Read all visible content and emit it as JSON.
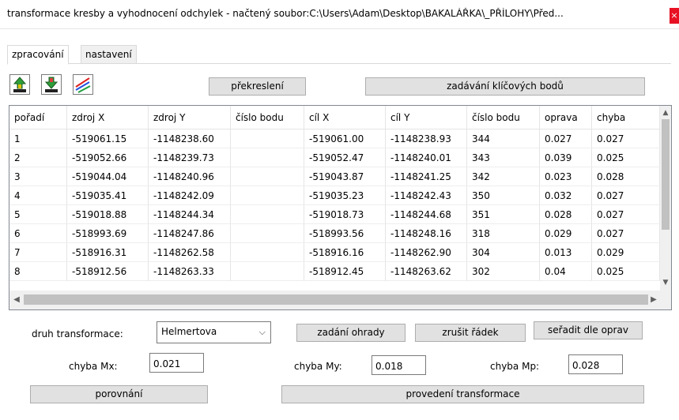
{
  "window": {
    "title": "transformace kresby a vyhodnocení odchylek - načtený soubor:C:\\Users\\Adam\\Desktop\\BAKALÁŘKA\\_PŘÍLOHY\\Před...",
    "close_glyph": "×"
  },
  "tabs": [
    {
      "label": "zpracování",
      "active": true
    },
    {
      "label": "nastavení",
      "active": false
    }
  ],
  "toolbar": {
    "icons": [
      "upload-arrow-icon",
      "download-arrow-icon",
      "line-chart-icon"
    ],
    "redraw_label": "překreslení",
    "keypoints_label": "zadávání klíčových bodů"
  },
  "table": {
    "columns": [
      "pořadí",
      "zdroj X",
      "zdroj Y",
      "číslo bodu",
      "cíl X",
      "cíl Y",
      "číslo bodu",
      "oprava",
      "chyba"
    ],
    "rows": [
      [
        "1",
        "-519061.15",
        "-1148238.60",
        "",
        "-519061.00",
        "-1148238.93",
        "344",
        "0.027",
        "0.027"
      ],
      [
        "2",
        "-519052.66",
        "-1148239.73",
        "",
        "-519052.47",
        "-1148240.01",
        "343",
        "0.039",
        "0.025"
      ],
      [
        "3",
        "-519044.04",
        "-1148240.96",
        "",
        "-519043.87",
        "-1148241.25",
        "342",
        "0.023",
        "0.028"
      ],
      [
        "4",
        "-519035.41",
        "-1148242.09",
        "",
        "-519035.23",
        "-1148242.43",
        "350",
        "0.032",
        "0.027"
      ],
      [
        "5",
        "-519018.88",
        "-1148244.34",
        "",
        "-519018.73",
        "-1148244.68",
        "351",
        "0.028",
        "0.027"
      ],
      [
        "6",
        "-518993.69",
        "-1148247.86",
        "",
        "-518993.56",
        "-1148248.16",
        "318",
        "0.029",
        "0.027"
      ],
      [
        "7",
        "-518916.31",
        "-1148262.58",
        "",
        "-518916.16",
        "-1148262.90",
        "304",
        "0.013",
        "0.029"
      ],
      [
        "8",
        "-518912.56",
        "-1148263.33",
        "",
        "-518912.45",
        "-1148263.62",
        "302",
        "0.04",
        "0.025"
      ]
    ]
  },
  "controls": {
    "transform_type_label": "druh transformace:",
    "transform_type_value": "Helmertova",
    "fence_label": "zadání ohrady",
    "delete_row_label": "zrušit řádek",
    "sort_label": "seřadit dle oprav",
    "mx_label": "chyba Mx:",
    "mx_value": "0.021",
    "my_label": "chyba My:",
    "my_value": "0.018",
    "mp_label": "chyba Mp:",
    "mp_value": "0.028",
    "compare_label": "porovnání",
    "execute_label": "provedení transformace"
  }
}
